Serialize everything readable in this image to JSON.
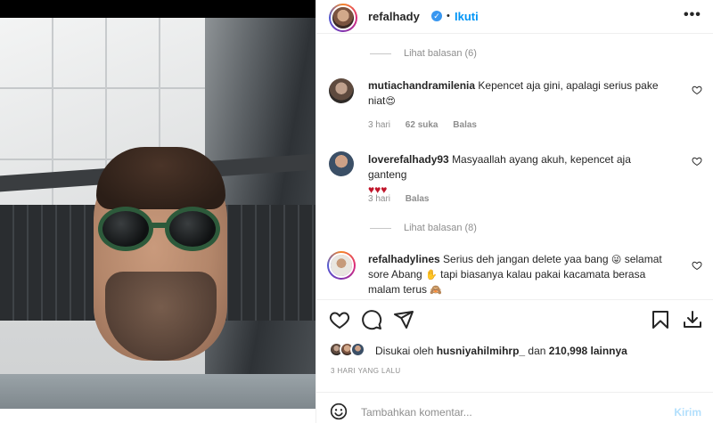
{
  "header": {
    "username": "refalhady",
    "verified_icon": "verified-badge-icon",
    "separator": "•",
    "follow_label": "Ikuti",
    "more_icon": "more-options-icon"
  },
  "thread": {
    "view_replies_1": "Lihat balasan (6)",
    "comments": [
      {
        "username": "mutiachandramilenia",
        "text": "Kepencet aja gini, apalagi serius pake niat",
        "emoji": "😍",
        "time": "3 hari",
        "likes": "62 suka",
        "reply": "Balas"
      },
      {
        "username": "loverefalhady93",
        "text": "Masyaallah ayang akuh, kepencet aja ganteng",
        "emoji": "♥♥♥",
        "time": "3 hari",
        "reply": "Balas"
      }
    ],
    "view_replies_2": "Lihat balasan (8)",
    "last_comment": {
      "username": "refalhadylines",
      "text_1": "Serius deh jangan delete yaa bang",
      "emoji_1": "😜",
      "text_2": "selamat sore Abang",
      "emoji_2": "✋",
      "text_3": "tapi biasanya kalau pakai kacamata berasa malam terus",
      "emoji_3": "🙈"
    }
  },
  "actions": {
    "like_icon": "heart-icon",
    "comment_icon": "comment-icon",
    "share_icon": "share-icon",
    "save_icon": "bookmark-icon",
    "download_icon": "download-icon"
  },
  "likes": {
    "prefix": "Disukai oleh",
    "user": "husniyahilmihrp_",
    "middle": "dan",
    "count": "210,998 lainnya"
  },
  "timestamp": "3 HARI YANG LALU",
  "add_comment": {
    "emoji_icon": "emoji-icon",
    "placeholder": "Tambahkan komentar...",
    "post_label": "Kirim"
  }
}
